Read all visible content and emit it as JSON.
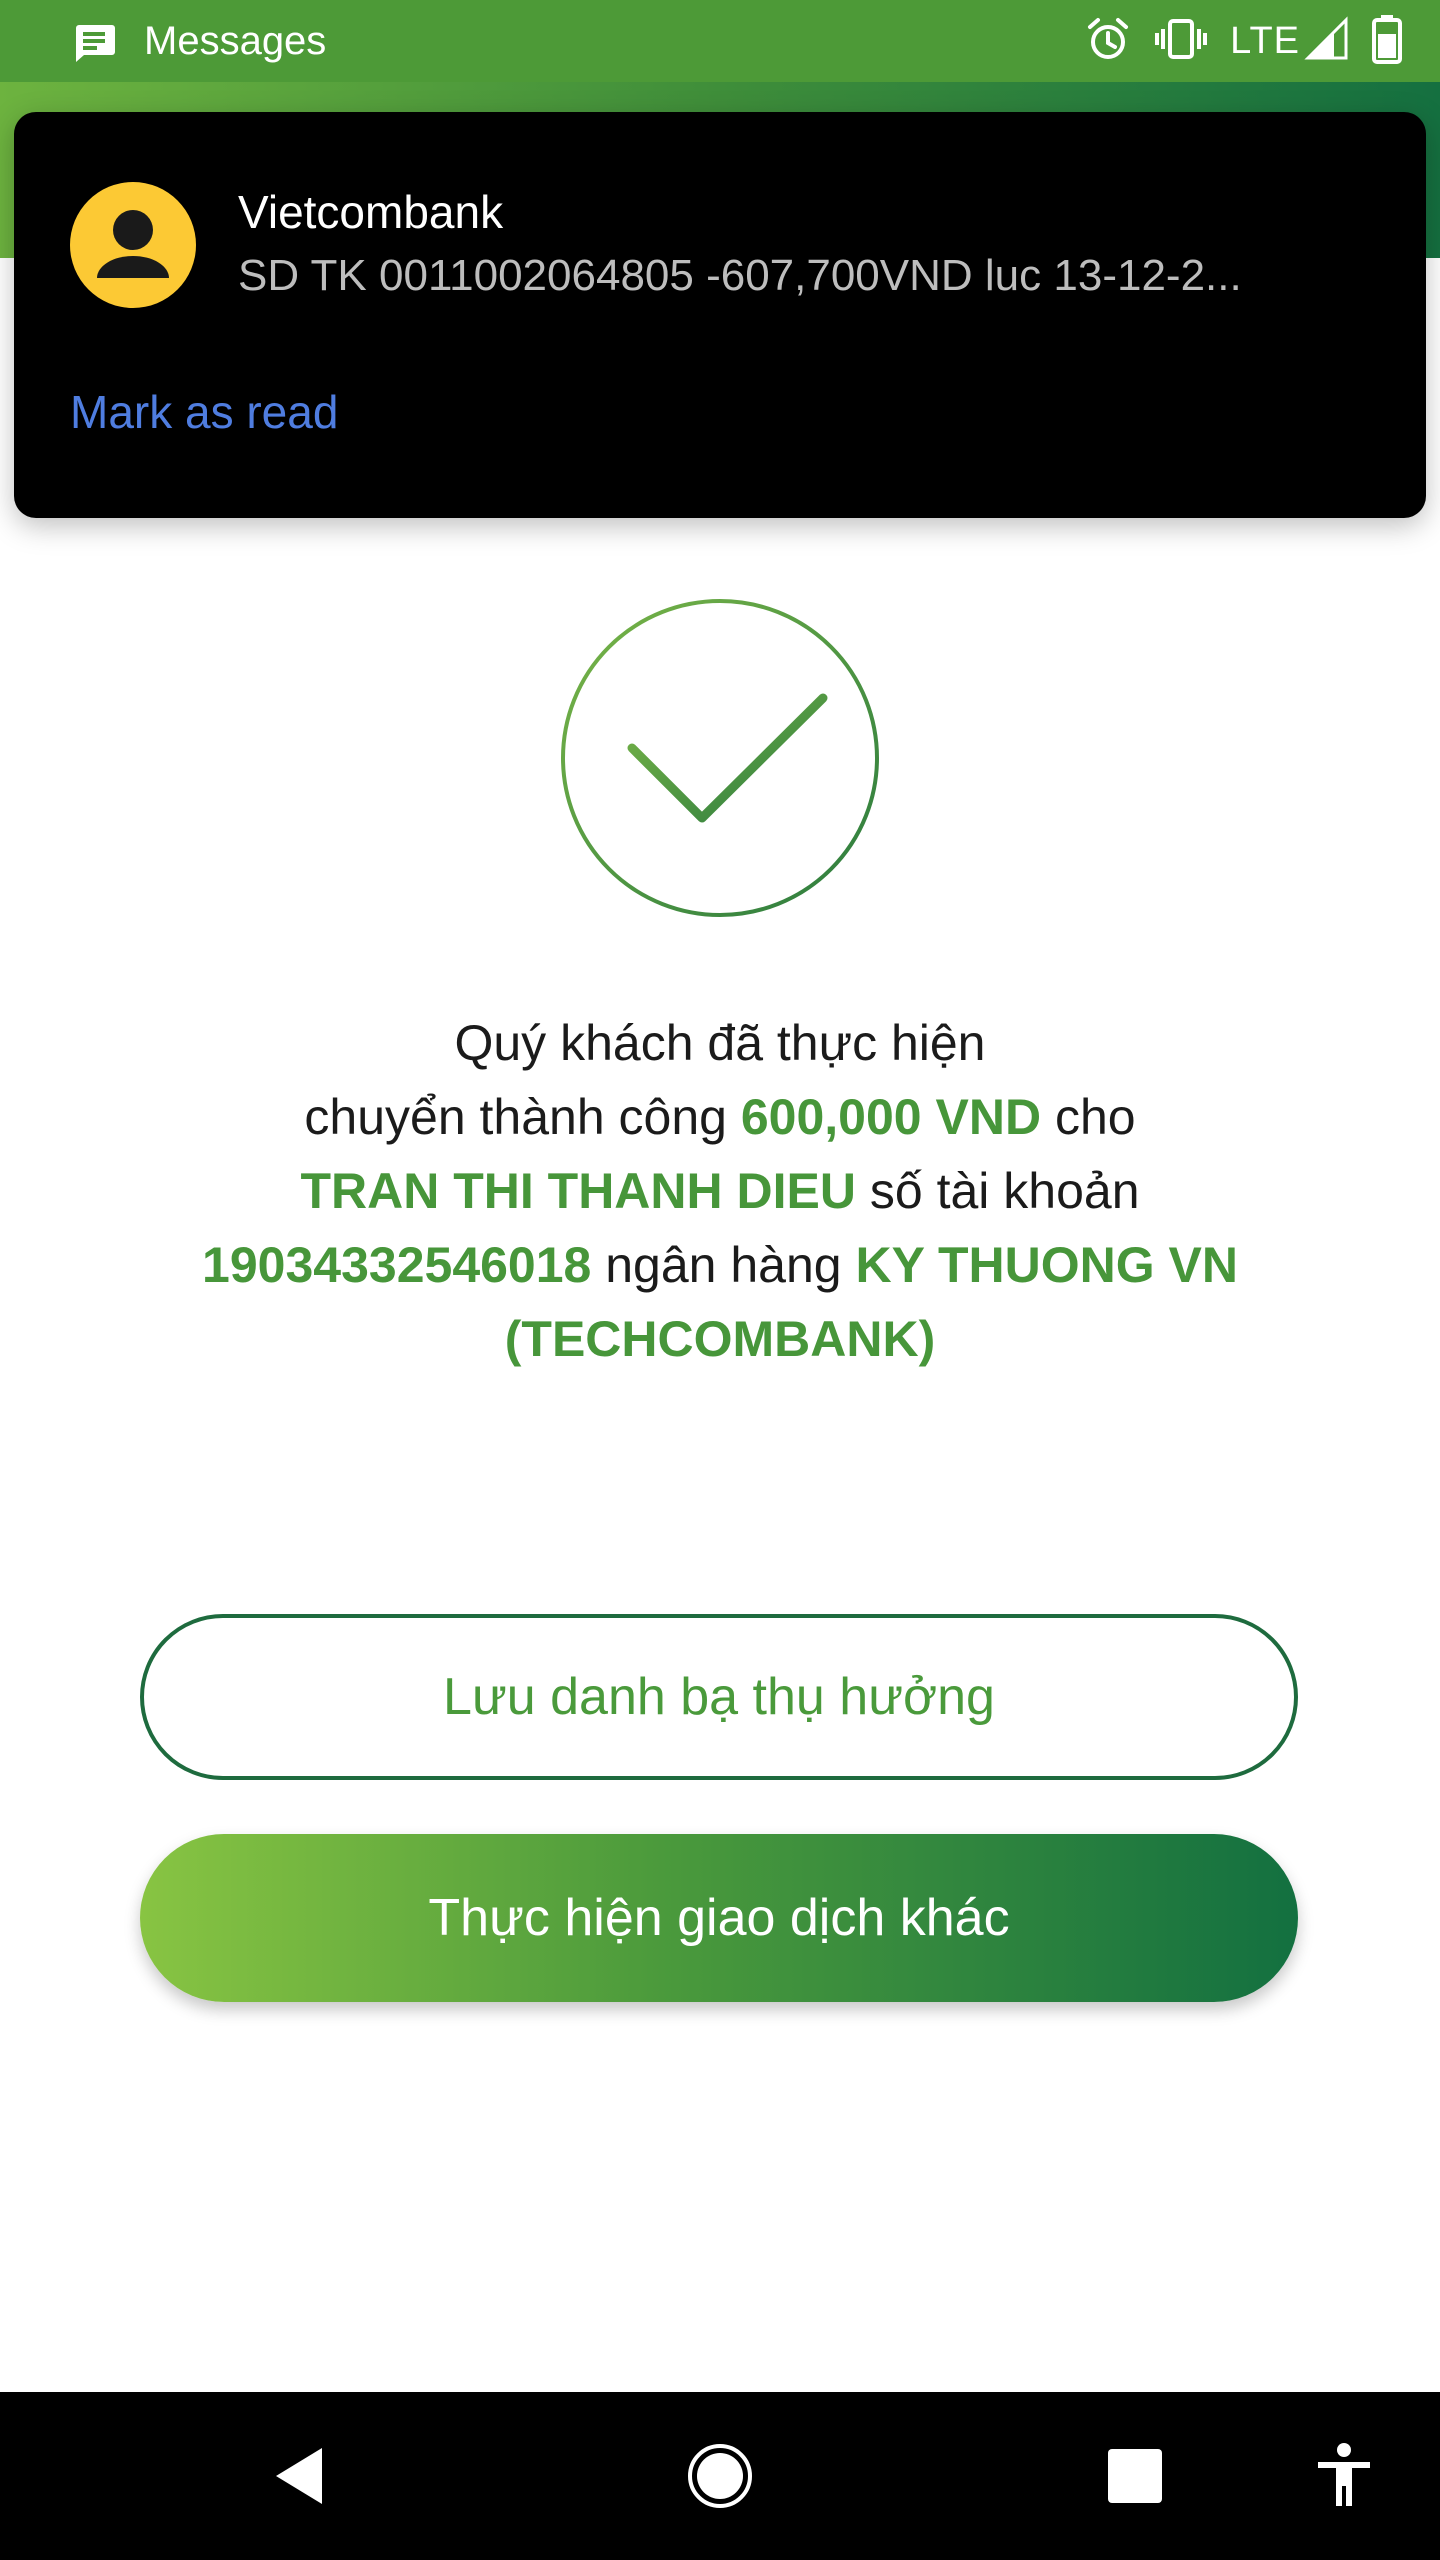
{
  "status_bar": {
    "app_name": "Messages",
    "network": "LTE",
    "icons": [
      "messages-icon",
      "alarm-icon",
      "vibrate-icon",
      "signal-icon",
      "battery-icon"
    ]
  },
  "notification": {
    "sender": "Vietcombank",
    "body": "SD TK 0011002064805 -607,700VND luc 13-12-2...",
    "action_label": "Mark as read",
    "avatar_icon": "person-icon"
  },
  "result": {
    "status_icon": "check-circle-icon",
    "line1": "Quý khách đã thực hiện",
    "line2_prefix": "chuyển thành công ",
    "amount": "600,000 VND",
    "line2_suffix": " cho",
    "recipient_name": "TRAN THI THANH DIEU",
    "account_label": " số tài khoản",
    "account_number": "19034332546018",
    "bank_label": " ngân hàng ",
    "bank_name": "KY THUONG VN (TECHCOMBANK)"
  },
  "actions": {
    "save_contact_label": "Lưu danh bạ thụ hưởng",
    "new_transaction_label": "Thực hiện giao dịch khác"
  },
  "nav_bar": {
    "icons": [
      "back-icon",
      "home-icon",
      "recents-icon",
      "accessibility-icon"
    ]
  },
  "colors": {
    "brand_green": "#47963a",
    "brand_dark_green": "#137040",
    "notification_action": "#4f7de0",
    "avatar_yellow": "#fcc934"
  }
}
